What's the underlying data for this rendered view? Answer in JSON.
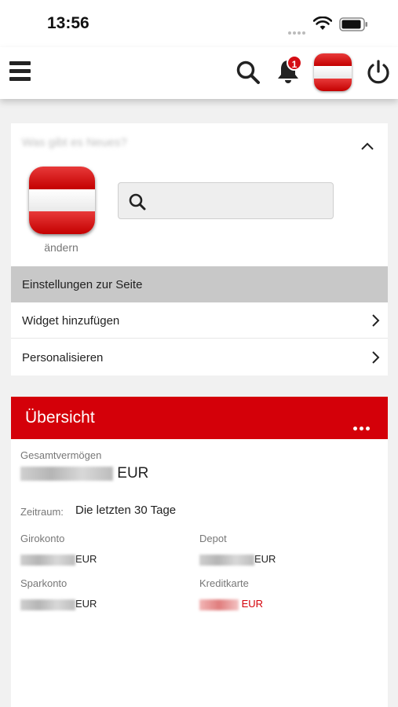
{
  "status_bar": {
    "time": "13:56"
  },
  "nav": {
    "notification_count": "1"
  },
  "panel": {
    "greeting": "Was gibt es Neues?",
    "change_label": "ändern",
    "search_placeholder": "",
    "settings_header": "Einstellungen zur Seite",
    "items": [
      {
        "label": "Widget hinzufügen"
      },
      {
        "label": "Personalisieren"
      }
    ]
  },
  "overview": {
    "title": "Übersicht",
    "total_label": "Gesamtvermögen",
    "total_currency": "EUR",
    "period_label": "Zeitraum:",
    "period_value": "Die letzten 30 Tage",
    "accounts": [
      {
        "label": "Girokonto",
        "currency": "EUR"
      },
      {
        "label": "Depot",
        "currency": "EUR"
      },
      {
        "label": "Sparkonto",
        "currency": "EUR"
      },
      {
        "label": "Kreditkarte",
        "currency": "EUR"
      }
    ]
  },
  "colors": {
    "brand_red": "#d40009",
    "badge_red": "#d40d14"
  }
}
